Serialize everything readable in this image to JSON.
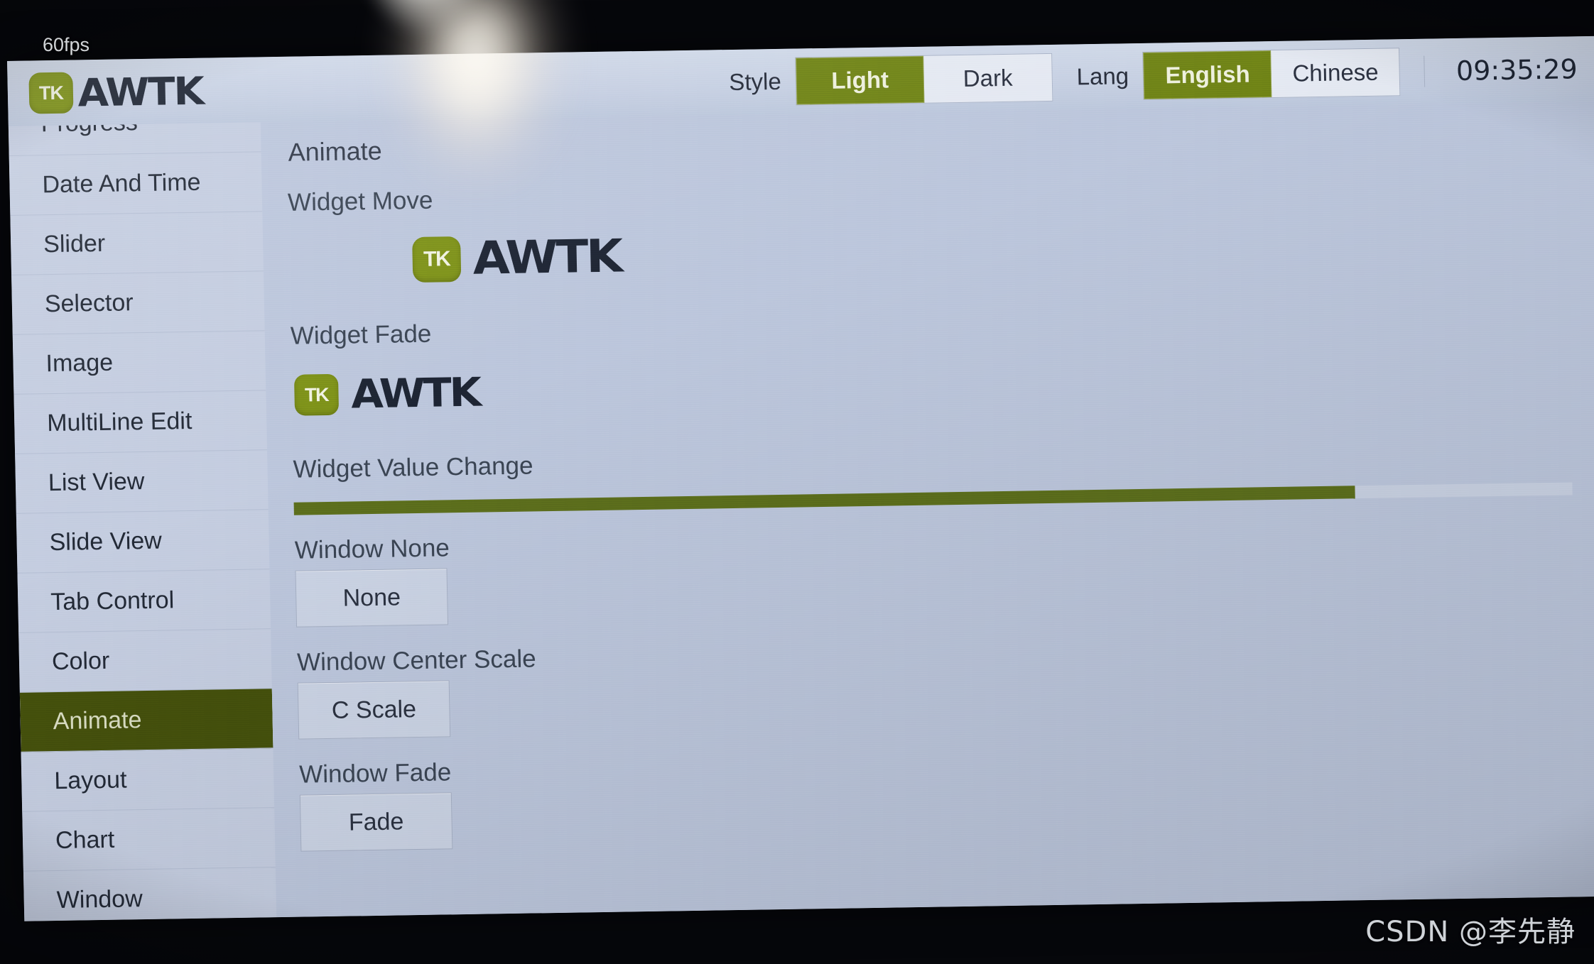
{
  "overlay": {
    "fps": "60fps",
    "watermark": "CSDN @李先静"
  },
  "topbar": {
    "logo_badge": "TK",
    "logo_word": "AWTK",
    "style_label": "Style",
    "style_options": [
      "Light",
      "Dark"
    ],
    "style_selected": "Light",
    "lang_label": "Lang",
    "lang_options": [
      "English",
      "Chinese"
    ],
    "lang_selected": "English",
    "clock": "09:35:29"
  },
  "sidebar": {
    "items": [
      {
        "label": "Progress",
        "active": false,
        "clipped": true
      },
      {
        "label": "Date And Time",
        "active": false,
        "clipped": false
      },
      {
        "label": "Slider",
        "active": false,
        "clipped": false
      },
      {
        "label": "Selector",
        "active": false,
        "clipped": false
      },
      {
        "label": "Image",
        "active": false,
        "clipped": false
      },
      {
        "label": "MultiLine Edit",
        "active": false,
        "clipped": false
      },
      {
        "label": "List View",
        "active": false,
        "clipped": false
      },
      {
        "label": "Slide View",
        "active": false,
        "clipped": false
      },
      {
        "label": "Tab Control",
        "active": false,
        "clipped": false
      },
      {
        "label": "Color",
        "active": false,
        "clipped": false
      },
      {
        "label": "Animate",
        "active": true,
        "clipped": false
      },
      {
        "label": "Layout",
        "active": false,
        "clipped": false
      },
      {
        "label": "Chart",
        "active": false,
        "clipped": false
      },
      {
        "label": "Window",
        "active": false,
        "clipped": false
      }
    ]
  },
  "content": {
    "page_title": "Animate",
    "widget_move": {
      "label": "Widget Move",
      "badge": "TK",
      "word": "AWTK"
    },
    "widget_fade": {
      "label": "Widget Fade",
      "badge": "TK",
      "word": "AWTK"
    },
    "widget_value_change": {
      "label": "Widget Value Change",
      "progress_percent": 83
    },
    "window_none": {
      "label": "Window None",
      "button": "None"
    },
    "window_center_scale": {
      "label": "Window Center Scale",
      "button": "C Scale"
    },
    "window_fade": {
      "label": "Window Fade",
      "button": "Fade"
    }
  },
  "colors": {
    "accent_green": "#6f8316",
    "active_green": "#44500c",
    "progress_green": "#5c6e1c",
    "panel_bg": "#bcc6dc",
    "sidebar_bg": "#c4cde0",
    "text": "#222936"
  }
}
